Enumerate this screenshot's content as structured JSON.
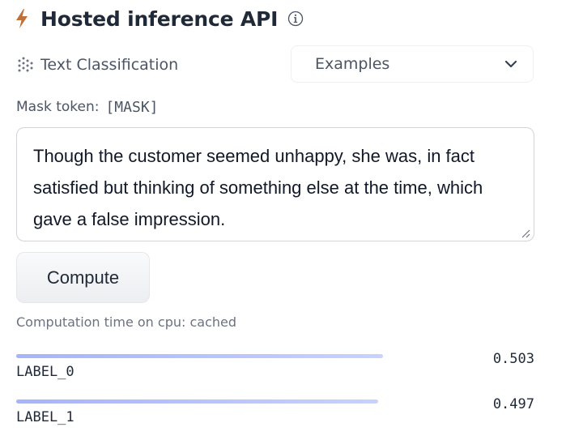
{
  "header": {
    "title": "Hosted inference API",
    "icon": "lightning-icon",
    "info_icon": "info-icon"
  },
  "task": {
    "label": "Text Classification",
    "icon": "text-classification-icon"
  },
  "examples": {
    "label": "Examples",
    "icon": "chevron-down-icon"
  },
  "mask": {
    "label": "Mask token:",
    "value": "[MASK]"
  },
  "input": {
    "value": "Though the customer seemed unhappy, she was, in fact satisfied but thinking of something else at the time, which gave a false impression."
  },
  "compute_button": {
    "label": "Compute"
  },
  "computation_time": "Computation time on cpu: cached",
  "results": [
    {
      "label": "LABEL_0",
      "score": "0.503",
      "fraction": 0.503
    },
    {
      "label": "LABEL_1",
      "score": "0.497",
      "fraction": 0.497
    }
  ],
  "colors": {
    "accent_bolt": "#c0703a",
    "bar_start": "#a5b4fc",
    "bar_end": "#c7d2fe"
  }
}
